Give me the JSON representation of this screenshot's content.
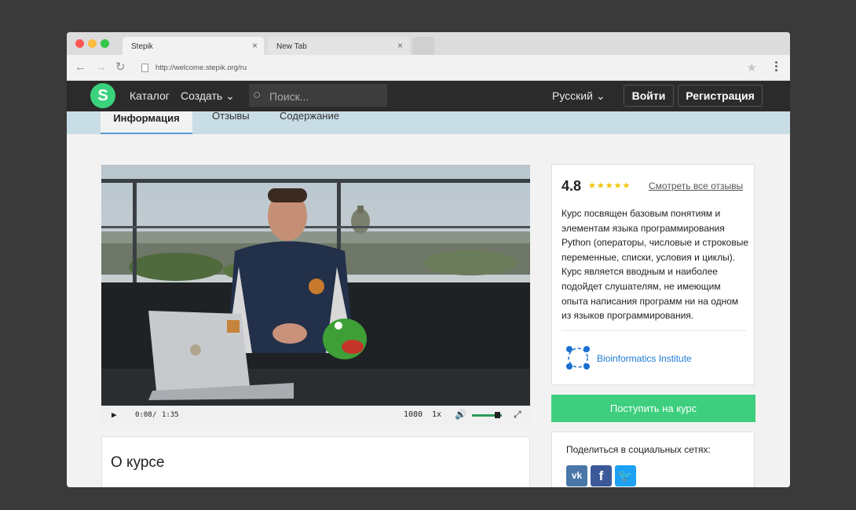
{
  "browser": {
    "tabs": [
      {
        "title": "Stepik",
        "close": "×"
      },
      {
        "title": "New Tab",
        "close": "×"
      }
    ],
    "url": "http://welcome.stepik.org/ru"
  },
  "header": {
    "logo_letter": "S",
    "catalog": "Каталог",
    "create": "Создать",
    "search_placeholder": "Поиск...",
    "language": "Русский",
    "login": "Войти",
    "register": "Регистрация"
  },
  "course_tabs": {
    "info": "Информация",
    "reviews": "Отзывы",
    "contents": "Содержание"
  },
  "video": {
    "current_time": "0:08",
    "separator": "/",
    "duration": "1:35",
    "quality": "1080",
    "speed": "1x",
    "progress": 0.084,
    "volume": 0.85
  },
  "about": {
    "title": "О курсе"
  },
  "sidebar": {
    "rating": "4.8",
    "stars": "★★★★★",
    "reviews_link": "Смотреть все отзывы",
    "description": "Курс посвящен базовым понятиям и элементам языка программирования Python (операторы, числовые и строковые переменные, списки, условия и циклы). Курс является вводным и наиболее подойдет слушателям, не имеющим опыта написания программ ни на одном из языков программирования.",
    "organization": "Bioinformatics Institute",
    "enroll": "Поступить на курс",
    "share_title": "Поделиться в социальных сетях:",
    "social": {
      "vk": "vk",
      "facebook": "f",
      "twitter": "twitter"
    }
  },
  "colors": {
    "header_bg": "#2b2b2b",
    "brand_green": "#3bd27d",
    "enroll_green": "#3dcf7d",
    "link_blue": "#1f7ad6",
    "star_yellow": "#f2c300"
  }
}
